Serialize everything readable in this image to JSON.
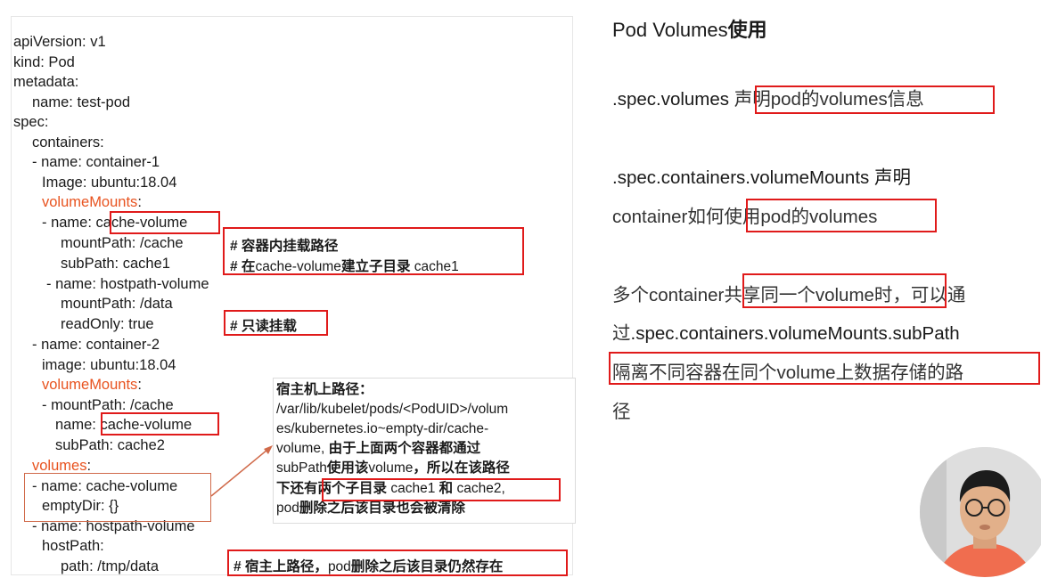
{
  "yaml": {
    "l1": "apiVersion: v1",
    "l2": "kind: Pod",
    "l3": "metadata:",
    "l4": "name: test-pod",
    "l5": "spec:",
    "l6": "containers:",
    "l7": "- name: container-1",
    "l8": "Image: ubuntu:18.04",
    "l9": "volumeMounts",
    "l9b": ":",
    "l10a": "- name: ",
    "l10b": "cache-volume",
    "l11": "mountPath: /cache",
    "l12": "subPath: cache1",
    "l13": "- name: hostpath-volume",
    "l14": "mountPath: /data",
    "l15": "readOnly: true",
    "l16": "- name: container-2",
    "l17": "image: ubuntu:18.04",
    "l18": "volumeMounts",
    "l18b": ":",
    "l19": "- mountPath: /cache",
    "l20a": "name: ",
    "l20b": "cache-volume",
    "l21": "subPath: cache2",
    "l22": "volumes",
    "l22b": ":",
    "l23": "- name: cache-volume",
    "l24": "emptyDir: {}",
    "l25": "- name: hostpath-volume",
    "l26": "hostPath:",
    "l27": "path: /tmp/data"
  },
  "annotations": {
    "a1": "# 容器内挂载路径",
    "a2a": "# 在",
    "a2b": "cache-volume",
    "a2c": "建立子目录",
    "a2d": " cache1",
    "a3": "# 只读挂载",
    "a4a": "# 宿主上路径，",
    "a4b": "pod",
    "a4c": "删除之后该目录仍然存在"
  },
  "host_note": {
    "title": "宿主机上路径：",
    "p1": "/var/lib/kubelet/pods/<PodUID>/volum",
    "p2": "es/kubernetes.io~empty-dir/cache-",
    "p3a": "volume, ",
    "p3b": "由于上面两个容器都通过",
    "p4a": "subPath",
    "p4b": "使用该",
    "p4c": "volume",
    "p4d": "，所以在该路径",
    "p5a": "下还有",
    "p5b": "两个子目录",
    "p5c": " cache1 ",
    "p5d": "和",
    "p5e": " cache2,",
    "p6a": "pod",
    "p6b": "删除之后该目录也会被清除"
  },
  "slide": {
    "title_a": "Pod Volumes",
    "title_b": "使用",
    "s1a": ".spec.volumes ",
    "s1b": "声明pod的volumes信息",
    "s2a": ".spec.containers.volumeMounts 声明",
    "s2b": "container如何",
    "s2c": "使用pod的volumes",
    "s3a": "多个container",
    "s3b": "共享同一个volume时",
    "s3c": "，可以通",
    "s3d": "过",
    "s3e": ".spec.containers.volumeMounts.subPath",
    "s3f": "隔离不同容器在同个volume上数据存储的路",
    "s3g": "径"
  },
  "colors": {
    "highlight_box": "#e01a1a",
    "yaml_key_accent": "#e8531f"
  }
}
